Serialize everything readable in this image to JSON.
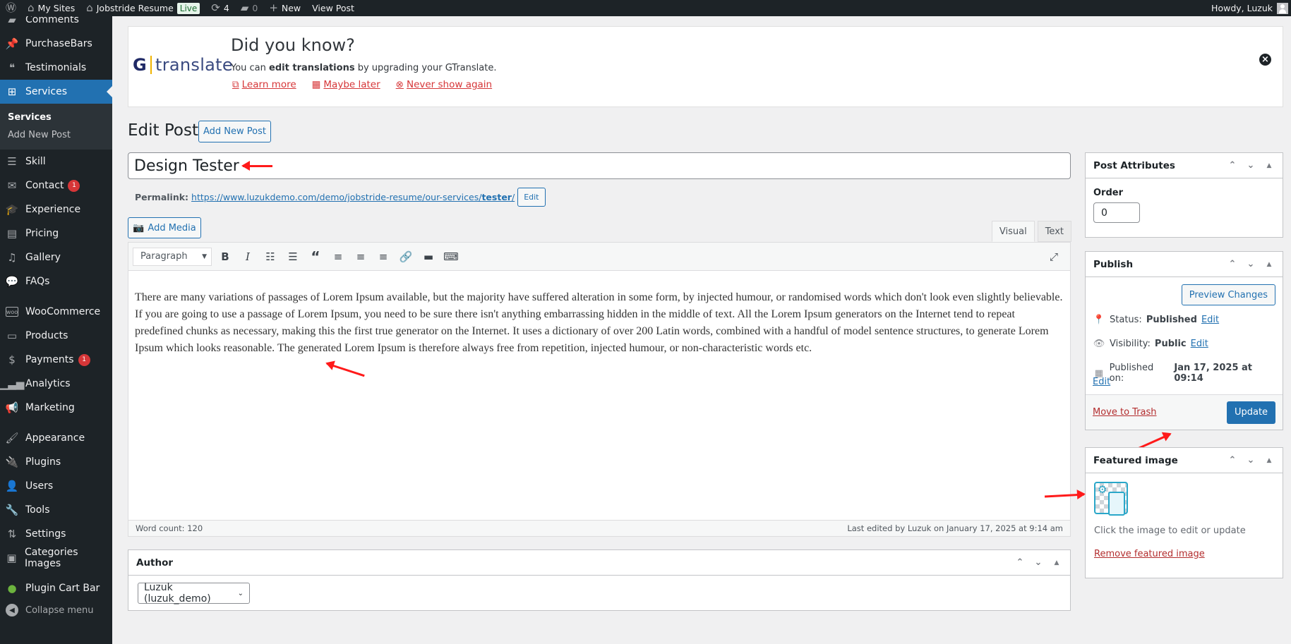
{
  "adminbar": {
    "my_sites": "My Sites",
    "site_name": "Jobstride Resume",
    "live_badge": "Live",
    "updates_count": "4",
    "comments_count": "0",
    "new_label": "New",
    "view_post": "View Post",
    "howdy": "Howdy, Luzuk"
  },
  "sidebar": {
    "items": [
      {
        "label": "Comments",
        "icon": "comment-icon"
      },
      {
        "label": "PurchaseBars",
        "icon": "pin-icon"
      },
      {
        "label": "Testimonials",
        "icon": "testimonial-icon"
      },
      {
        "label": "Services",
        "icon": "grid-icon"
      },
      {
        "label": "Skill",
        "icon": "list-icon"
      },
      {
        "label": "Contact",
        "icon": "mail-icon",
        "badge": "1"
      },
      {
        "label": "Experience",
        "icon": "education-icon"
      },
      {
        "label": "Pricing",
        "icon": "tickets-icon"
      },
      {
        "label": "Gallery",
        "icon": "media-icon"
      },
      {
        "label": "FAQs",
        "icon": "chat-icon"
      },
      {
        "label": "WooCommerce",
        "icon": "woo-icon"
      },
      {
        "label": "Products",
        "icon": "archive-icon"
      },
      {
        "label": "Payments",
        "icon": "dollar-icon",
        "badge": "1"
      },
      {
        "label": "Analytics",
        "icon": "chart-icon"
      },
      {
        "label": "Marketing",
        "icon": "megaphone-icon"
      },
      {
        "label": "Appearance",
        "icon": "brush-icon"
      },
      {
        "label": "Plugins",
        "icon": "plugin-icon"
      },
      {
        "label": "Users",
        "icon": "user-icon"
      },
      {
        "label": "Tools",
        "icon": "wrench-icon"
      },
      {
        "label": "Settings",
        "icon": "settings-icon"
      },
      {
        "label": "Categories Images",
        "icon": "image-icon"
      },
      {
        "label": "Plugin Cart Bar",
        "icon": "cart-bar-icon"
      }
    ],
    "submenu": [
      "Services",
      "Add New Post"
    ],
    "collapse": "Collapse menu"
  },
  "notice": {
    "logo_g": "G",
    "logo_text": "translate",
    "title": "Did you know?",
    "text_pre": "You can ",
    "text_bold": "edit translations",
    "text_post": " by upgrading your GTranslate.",
    "learn_more": "Learn more",
    "maybe_later": "Maybe later",
    "never_show": "Never show again"
  },
  "page": {
    "title": "Edit Post",
    "add_new": "Add New Post",
    "post_title": "Design Tester",
    "permalink_label": "Permalink:",
    "permalink_base": "https://www.luzukdemo.com/demo/jobstride-resume/our-services/",
    "permalink_slug": "tester",
    "permalink_end": "/",
    "permalink_edit": "Edit"
  },
  "editor": {
    "add_media": "Add Media",
    "tab_visual": "Visual",
    "tab_text": "Text",
    "format": "Paragraph",
    "content": "There are many variations of passages of Lorem Ipsum available, but the majority have suffered alteration in some form, by injected humour, or randomised words which don't look even slightly believable. If you are going to use a passage of Lorem Ipsum, you need to be sure there isn't anything embarrassing hidden in the middle of text. All the Lorem Ipsum generators on the Internet tend to repeat predefined chunks as necessary, making this the first true generator on the Internet. It uses a dictionary of over 200 Latin words, combined with a handful of model sentence structures, to generate Lorem Ipsum which looks reasonable. The generated Lorem Ipsum is therefore always free from repetition, injected humour, or non-characteristic words etc.",
    "word_count": "Word count: 120",
    "last_edited": "Last edited by Luzuk on January 17, 2025 at 9:14 am"
  },
  "author": {
    "title": "Author",
    "selected": "Luzuk (luzuk_demo)"
  },
  "attributes": {
    "title": "Post Attributes",
    "order_label": "Order",
    "order_value": "0"
  },
  "publish": {
    "title": "Publish",
    "preview": "Preview Changes",
    "status_label": "Status: ",
    "status_value": "Published",
    "visibility_label": "Visibility: ",
    "visibility_value": "Public",
    "published_label": "Published on: ",
    "published_value": "Jan 17, 2025 at 09:14",
    "edit": "Edit",
    "trash": "Move to Trash",
    "update": "Update"
  },
  "featured": {
    "title": "Featured image",
    "hint": "Click the image to edit or update",
    "remove": "Remove featured image"
  },
  "colors": {
    "accent": "#2271b1",
    "sidebar_bg": "#1d2327",
    "danger": "#d63638",
    "annotation_arrow": "#ff1a1a"
  }
}
